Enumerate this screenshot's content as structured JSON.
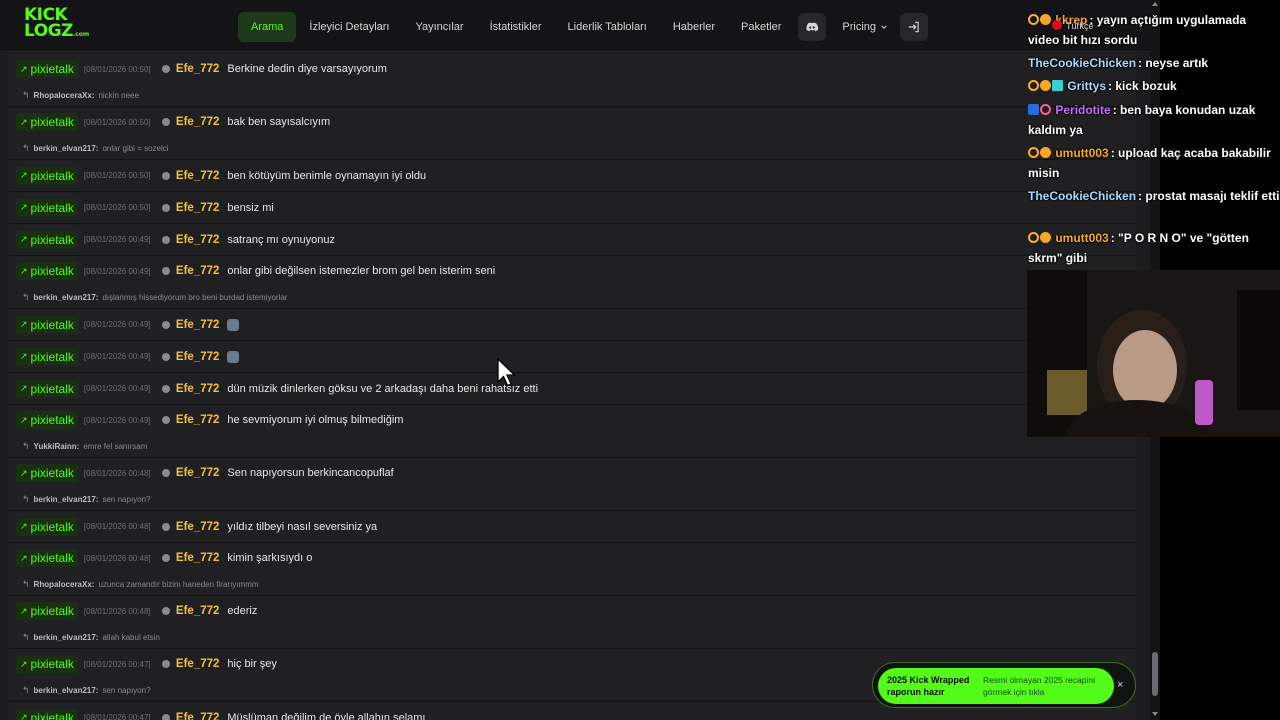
{
  "nav": {
    "logo_line1": "KICK",
    "logo_line2": "LOGZ",
    "logo_suffix": ".com",
    "items": [
      {
        "label": "Arama",
        "active": true
      },
      {
        "label": "İzleyici Detayları",
        "active": false
      },
      {
        "label": "Yayıncılar",
        "active": false
      },
      {
        "label": "İstatistikler",
        "active": false
      },
      {
        "label": "Liderlik Tabloları",
        "active": false
      },
      {
        "label": "Haberler",
        "active": false
      },
      {
        "label": "Paketler",
        "active": false
      }
    ],
    "discord_icon": "discord-icon",
    "pricing_label": "Pricing",
    "login_icon": "login-icon"
  },
  "chat": {
    "messages": [
      {
        "channel": "pixietalk",
        "timestamp": "[08/01/2026 00:50]",
        "user": "Efe_772",
        "text": "Berkine dedin diye varsayıyorum",
        "reply_user": "RhopaloceraXx:",
        "reply_text": "nickin neee"
      },
      {
        "channel": "pixietalk",
        "timestamp": "[08/01/2026 00:50]",
        "user": "Efe_772",
        "text": "bak ben sayısalcıyım",
        "reply_user": "berkin_elvan217:",
        "reply_text": "onlar gibi = sozelci"
      },
      {
        "channel": "pixietalk",
        "timestamp": "[08/01/2026 00:50]",
        "user": "Efe_772",
        "text": "ben kötüyüm benimle oynamayın iyi oldu"
      },
      {
        "channel": "pixietalk",
        "timestamp": "[08/01/2026 00:50]",
        "user": "Efe_772",
        "text": "bensiz mi"
      },
      {
        "channel": "pixietalk",
        "timestamp": "[08/01/2026 00:49]",
        "user": "Efe_772",
        "text": "satranç mı oynuyonuz"
      },
      {
        "channel": "pixietalk",
        "timestamp": "[08/01/2026 00:49]",
        "user": "Efe_772",
        "text": "onlar gibi değilsen istemezler brom gel ben isterim seni",
        "reply_user": "berkin_elvan217:",
        "reply_text": "dışlanmış hissediyorum bro beni burdad istemiyorlar"
      },
      {
        "channel": "pixietalk",
        "timestamp": "[08/01/2026 00:49]",
        "user": "Efe_772",
        "text": "",
        "emoji": true
      },
      {
        "channel": "pixietalk",
        "timestamp": "[08/01/2026 00:49]",
        "user": "Efe_772",
        "text": "",
        "emoji": true
      },
      {
        "channel": "pixietalk",
        "timestamp": "[08/01/2026 00:49]",
        "user": "Efe_772",
        "text": "dün müzik dinlerken göksu ve 2 arkadaşı daha beni rahatsız etti"
      },
      {
        "channel": "pixietalk",
        "timestamp": "[08/01/2026 00:49]",
        "user": "Efe_772",
        "text": "he sevmiyorum iyi olmuş bilmediğim",
        "reply_user": "YukkiRainn:",
        "reply_text": "emre fel sanırsam"
      },
      {
        "channel": "pixietalk",
        "timestamp": "[08/01/2026 00:48]",
        "user": "Efe_772",
        "text": "Sen napıyorsun berkincancopuflaf",
        "reply_user": "berkin_elvan217:",
        "reply_text": "sen napıyon?"
      },
      {
        "channel": "pixietalk",
        "timestamp": "[08/01/2026 00:48]",
        "user": "Efe_772",
        "text": "yıldız tilbeyi nasıl seversiniz ya"
      },
      {
        "channel": "pixietalk",
        "timestamp": "[08/01/2026 00:48]",
        "user": "Efe_772",
        "text": "kimin şarkısıydı o",
        "reply_user": "RhopaloceraXx:",
        "reply_text": "uzunca zamandır bizim haneden firarıyımmm"
      },
      {
        "channel": "pixietalk",
        "timestamp": "[08/01/2026 00:48]",
        "user": "Efe_772",
        "text": "ederiz",
        "reply_user": "berkin_elvan217:",
        "reply_text": "allah kabul etsin"
      },
      {
        "channel": "pixietalk",
        "timestamp": "[08/01/2026 00:47]",
        "user": "Efe_772",
        "text": "hiç bir şey",
        "reply_user": "berkin_elvan217:",
        "reply_text": "sen napıyon?"
      },
      {
        "channel": "pixietalk",
        "timestamp": "[08/01/2026 00:47]",
        "user": "Efe_772",
        "text": "Müslüman değilim de öyle allahın selamı"
      }
    ]
  },
  "toast": {
    "title": "2025 Kick Wrapped raporun hazır",
    "subtitle": "Resmi olmayan 2025 recapini görmek için tıkla",
    "close": "×"
  },
  "overlay": {
    "language": "Türkçe",
    "messages": [
      {
        "badges": [
          "q",
          "coin"
        ],
        "user": "kkrep",
        "user_color": "#f7a828",
        "text": "yayın açtığım uygulamada video bit hızı sordu"
      },
      {
        "badges": [],
        "user": "TheCookieChicken",
        "user_color": "#a9d8ff",
        "text": "neyse artık"
      },
      {
        "badges": [
          "q",
          "coin",
          "grid"
        ],
        "user": "Grittys",
        "user_color": "#a9d8ff",
        "text": "kick bozuk"
      },
      {
        "badges": [
          "blue",
          "pink"
        ],
        "user": "Peridotite",
        "user_color": "#c56bff",
        "text": "ben baya konudan uzak kaldım ya"
      },
      {
        "badges": [
          "q",
          "coin"
        ],
        "user": "umutt003",
        "user_color": "#f7a828",
        "text": "upload kaç acaba bakabilir misin"
      },
      {
        "badges": [],
        "user": "TheCookieChicken",
        "user_color": "#a9d8ff",
        "text": "prostat masajı teklif etti"
      },
      {
        "badges": [
          "q",
          "coin"
        ],
        "user": "umutt003",
        "user_color": "#f7a828",
        "text": "\"P O R N O\" ve \"götten skrm\" gibi"
      }
    ]
  },
  "colors": {
    "accent": "#53fc18",
    "username": "#f3c13a",
    "background": "#1c1c1f"
  }
}
